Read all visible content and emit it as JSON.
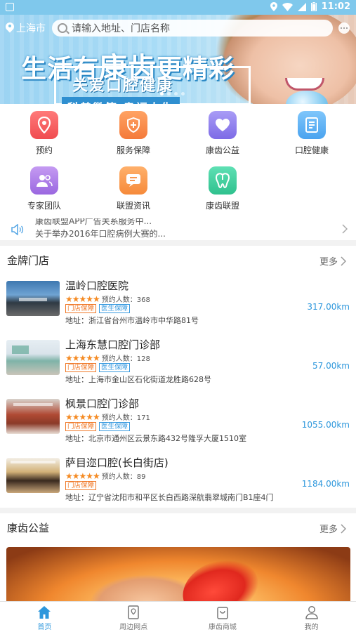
{
  "status_bar": {
    "time": "11:02"
  },
  "header": {
    "city": "上海市",
    "search_placeholder": "请输入地址、门店名称"
  },
  "banner": {
    "headline_part1": "生活有",
    "headline_part2": "康齿",
    "headline_part3": "更精彩",
    "subtitle": "关爱口腔健康",
    "subtitle2": "科普微笑 幸福人生"
  },
  "quick_actions": [
    {
      "label": "预约",
      "icon": "location-pin-icon"
    },
    {
      "label": "服务保障",
      "icon": "shield-plus-icon"
    },
    {
      "label": "康齿公益",
      "icon": "heart-icon"
    },
    {
      "label": "口腔健康",
      "icon": "document-icon"
    },
    {
      "label": "专家团队",
      "icon": "team-icon"
    },
    {
      "label": "联盟资讯",
      "icon": "message-icon"
    },
    {
      "label": "康齿联盟",
      "icon": "tooth-icon"
    }
  ],
  "news_ticker": {
    "line1": "康齿联盟APP广告关系服务中...",
    "line2": "关于举办2016年口腔病例大赛的..."
  },
  "gold_stores": {
    "title": "金牌门店",
    "more": "更多",
    "items": [
      {
        "name": "温岭口腔医院",
        "rating": 5,
        "booked_label": "预约人数：368",
        "tags": [
          "门店保障",
          "医生保障"
        ],
        "address": "地址：浙江省台州市温岭市中华路81号",
        "distance": "317.00km"
      },
      {
        "name": "上海东慧口腔门诊部",
        "rating": 5,
        "booked_label": "预约人数：128",
        "tags": [
          "门店保障",
          "医生保障"
        ],
        "address": "地址：上海市金山区石化街道龙胜路628号",
        "distance": "57.00km"
      },
      {
        "name": "枫景口腔门诊部",
        "rating": 5,
        "booked_label": "预约人数：171",
        "tags": [
          "门店保障",
          "医生保障"
        ],
        "address": "地址：北京市通州区云景东路432号隆孚大厦1510室",
        "distance": "1055.00km"
      },
      {
        "name": "萨目迩口腔(长白街店)",
        "rating": 5,
        "booked_label": "预约人数：89",
        "tags": [
          "门店保障"
        ],
        "address": "地址：辽宁省沈阳市和平区长白西路深航翡翠城南门B1座4门",
        "distance": "1184.00km"
      }
    ]
  },
  "charity": {
    "title": "康齿公益",
    "more": "更多"
  },
  "tabbar": [
    {
      "label": "首页",
      "icon": "home-icon",
      "active": true
    },
    {
      "label": "周边网点",
      "icon": "map-icon",
      "active": false
    },
    {
      "label": "康齿商城",
      "icon": "shop-icon",
      "active": false
    },
    {
      "label": "我的",
      "icon": "user-icon",
      "active": false
    }
  ],
  "colors": {
    "accent": "#2d97dc",
    "star": "#f58a22",
    "tag_orange": "#f07a2a",
    "tag_blue": "#3a9be0"
  }
}
